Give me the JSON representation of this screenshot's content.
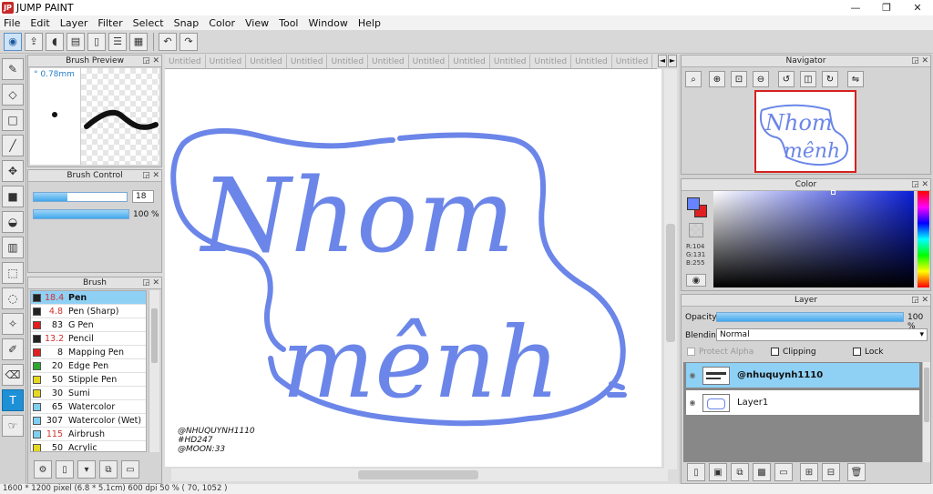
{
  "app": {
    "title": "JUMP PAINT",
    "logo": "JP",
    "controls": {
      "minimize": "—",
      "maximize": "❐",
      "close": "✕"
    }
  },
  "menu": [
    "File",
    "Edit",
    "Layer",
    "Filter",
    "Select",
    "Snap",
    "Color",
    "View",
    "Tool",
    "Window",
    "Help"
  ],
  "toolbar": {
    "icons": [
      "brush-mode-icon",
      "export-icon",
      "speech-bubble-icon",
      "comment-icon",
      "page-icon",
      "page-list-icon",
      "grid-icon"
    ],
    "undo": "↶",
    "redo": "↷"
  },
  "left_tools": [
    "pen-tool-icon",
    "eraser-tool-icon",
    "rect-select-icon",
    "line-tool-icon",
    "move-tool-icon",
    "fill-rect-icon",
    "bucket-tool-icon",
    "gradient-tool-icon",
    "marquee-select-icon",
    "lasso-select-icon",
    "magic-wand-icon",
    "select-pen-icon",
    "select-eraser-icon",
    "text-tool-icon",
    "hand-tool-icon"
  ],
  "brush_preview": {
    "title": "Brush Preview",
    "size_label": "° 0.78mm"
  },
  "brush_control": {
    "title": "Brush Control",
    "size_value": "18",
    "size_fill": 0.36,
    "opacity_value": "100 %",
    "opacity_fill": 1.0
  },
  "brush": {
    "title": "Brush",
    "items": [
      {
        "size": "18.4",
        "name": "Pen",
        "color": "#222222",
        "selected": true,
        "size_red": true
      },
      {
        "size": "4.8",
        "name": "Pen (Sharp)",
        "color": "#222222",
        "selected": false,
        "size_red": true
      },
      {
        "size": "83",
        "name": "G Pen",
        "color": "#e02020",
        "selected": false,
        "size_red": false
      },
      {
        "size": "13.2",
        "name": "Pencil",
        "color": "#222222",
        "selected": false,
        "size_red": true
      },
      {
        "size": "8",
        "name": "Mapping Pen",
        "color": "#e02020",
        "selected": false,
        "size_red": false
      },
      {
        "size": "20",
        "name": "Edge Pen",
        "color": "#2ea82e",
        "selected": false,
        "size_red": false
      },
      {
        "size": "50",
        "name": "Stipple Pen",
        "color": "#e6d820",
        "selected": false,
        "size_red": false
      },
      {
        "size": "30",
        "name": "Sumi",
        "color": "#e6d820",
        "selected": false,
        "size_red": false
      },
      {
        "size": "65",
        "name": "Watercolor",
        "color": "#7fd0f0",
        "selected": false,
        "size_red": false
      },
      {
        "size": "307",
        "name": "Watercolor (Wet)",
        "color": "#7fd0f0",
        "selected": false,
        "size_red": false
      },
      {
        "size": "115",
        "name": "Airbrush",
        "color": "#7fd0f0",
        "selected": false,
        "size_red": true
      },
      {
        "size": "50",
        "name": "Acrylic",
        "color": "#e6d820",
        "selected": false,
        "size_red": false
      }
    ]
  },
  "tabs": [
    "Untitled",
    "Untitled",
    "Untitled",
    "Untitled",
    "Untitled",
    "Untitled",
    "Untitled",
    "Untitled",
    "Untitled",
    "Untitled",
    "Untitled",
    "Untitled",
    "Untitled",
    "Untitled",
    "Untitled"
  ],
  "tab_prev": "◄",
  "tab_next": "►",
  "canvas": {
    "line1": "Nhom",
    "line2": "mênh",
    "credit1": "@NHUQUYNH1110",
    "credit2": "#HD247",
    "credit3": "@MOON:33",
    "ink_color": "#6b86e8"
  },
  "status": "1600 * 1200 pixel   (6.8 * 5.1cm)   600 dpi   50 %   ( 70, 1052 )",
  "navigator": {
    "title": "Navigator",
    "thumb_line1": "Nhom",
    "thumb_line2": "mênh"
  },
  "color": {
    "title": "Color",
    "r": "R:104",
    "g": "G:131",
    "b": "B:255",
    "fg": "#6883ff",
    "bg": "#e02020"
  },
  "layer": {
    "title": "Layer",
    "opacity_label": "Opacity",
    "opacity_value": "100 %",
    "opacity_fill": 1.0,
    "blending_label": "Blending",
    "blending_value": "Normal",
    "protect_alpha": "Protect Alpha",
    "clipping": "Clipping",
    "lock": "Lock",
    "layers": [
      {
        "name": "@nhuquynh1110",
        "selected": true
      },
      {
        "name": "Layer1",
        "selected": false
      }
    ]
  }
}
